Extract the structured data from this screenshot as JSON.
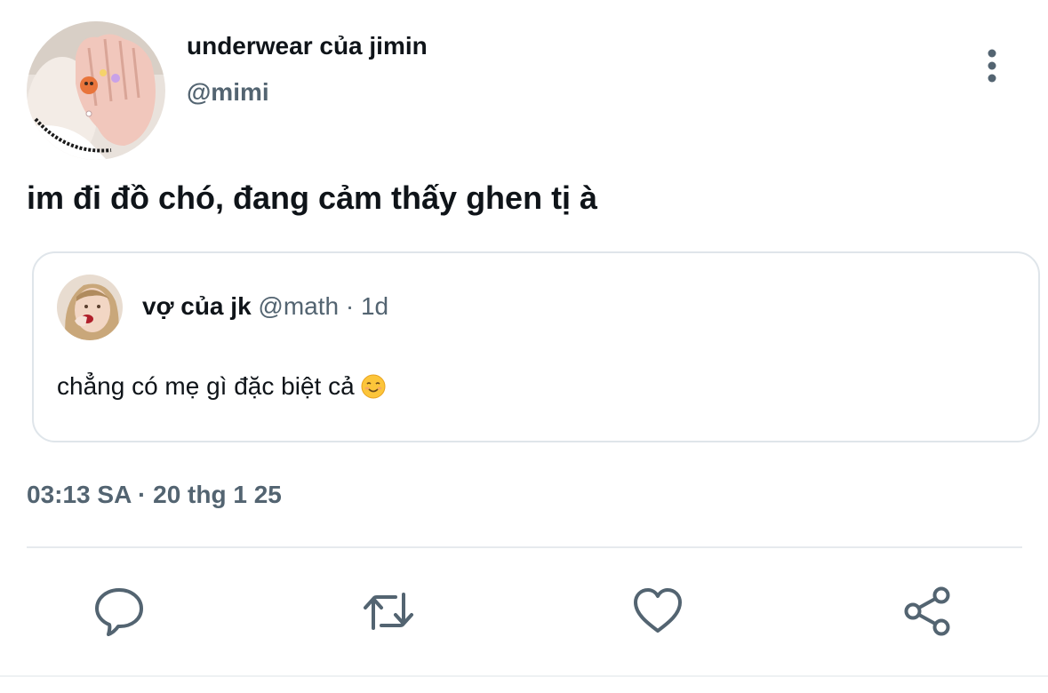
{
  "author": {
    "display_name": "underwear của jimin",
    "handle": "@mimi"
  },
  "tweet": {
    "text": "im đi đồ chó, đang cảm thấy ghen tị à",
    "timestamp": "03:13 SA · 20 thg 1 25"
  },
  "quoted_tweet": {
    "display_name": "vợ của jk",
    "handle": "@math",
    "separator": "·",
    "age": "1d",
    "text": "chẳng có mẹ gì đặc biệt cả",
    "emoji": "smiling-face-emoji"
  },
  "actions": [
    {
      "name": "reply",
      "icon": "speech-bubble-icon"
    },
    {
      "name": "retweet",
      "icon": "retweet-icon"
    },
    {
      "name": "like",
      "icon": "heart-icon"
    },
    {
      "name": "share",
      "icon": "share-icon"
    }
  ],
  "menu": {
    "icon": "vertical-ellipsis-icon"
  },
  "colors": {
    "text_primary": "#0f1419",
    "text_secondary": "#536471",
    "border": "#dfe5ea",
    "icon": "#536471"
  }
}
